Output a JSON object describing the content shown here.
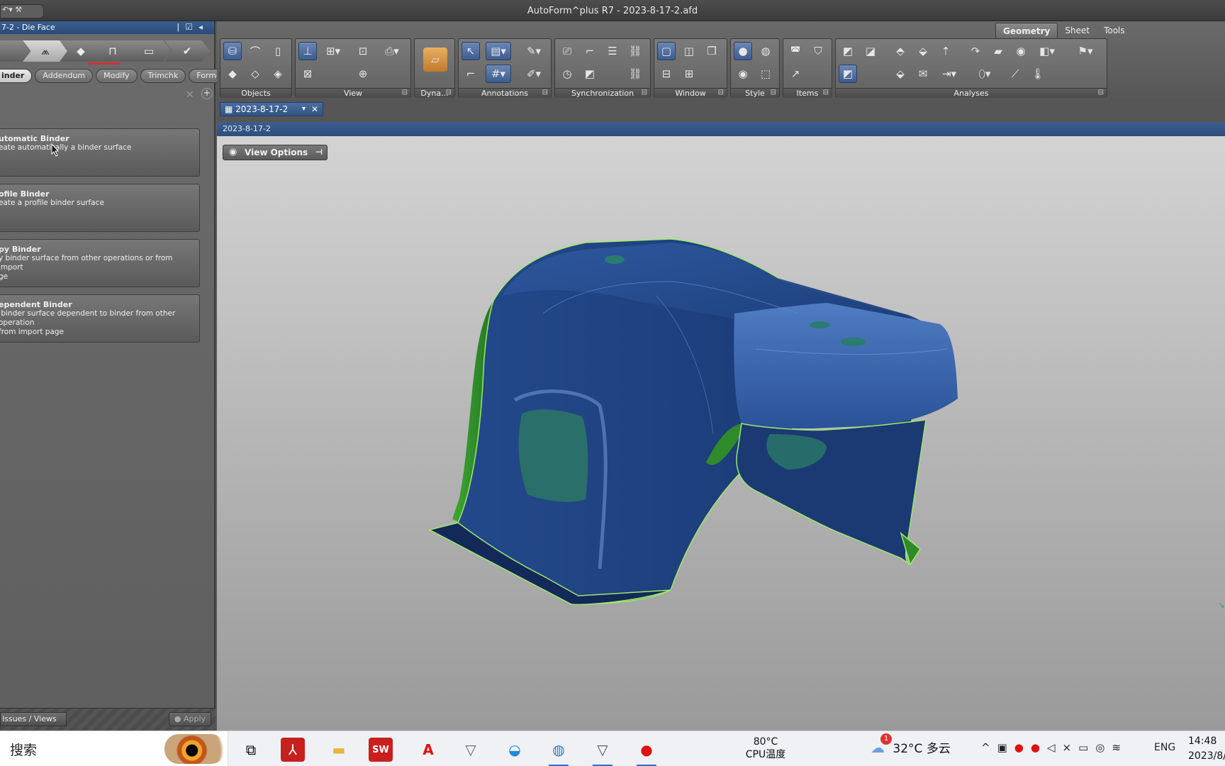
{
  "window": {
    "title": "AutoForm^plus R7 - 2023-8-17-2.afd"
  },
  "left_panel": {
    "header": "7-2 - Die Face",
    "subtabs": [
      "inder",
      "Addendum",
      "Modify",
      "Trimchk",
      "Formchk"
    ],
    "operations": [
      {
        "title": "utomatic Binder",
        "desc": "eate automatically a binder surface"
      },
      {
        "title": "ofile Binder",
        "desc": "eate a profile binder surface"
      },
      {
        "title": "py Binder",
        "desc": "y binder surface from other operations or from import\nge"
      },
      {
        "title": "ependent Binder",
        "desc": " binder surface dependent to binder from other operation\nfrom import page"
      }
    ],
    "issues_label": "Issues / Views",
    "apply_label": "Apply"
  },
  "ribbon": {
    "tabs": [
      "Geometry",
      "Sheet",
      "Tools"
    ],
    "groups": [
      "Objects",
      "View",
      "Dyna...",
      "Annotations",
      "Synchronization",
      "Window",
      "Style",
      "Items",
      "Analyses"
    ]
  },
  "document": {
    "tab_label": "2023-8-17-2",
    "viewport_title": "2023-8-17-2",
    "view_options_label": "View Options"
  },
  "taskbar": {
    "search_text": "搜索",
    "cpu_temp": "80°C",
    "cpu_label": "CPU温度",
    "weather_badge": "1",
    "weather_temp": "32°C",
    "weather_desc": "多云",
    "lang": "ENG",
    "time": "14:48",
    "date": "2023/8/"
  },
  "colors": {
    "part_blue": "#1e3f7a",
    "part_green": "#2f8a2a",
    "accent_blue": "#2f5383"
  }
}
